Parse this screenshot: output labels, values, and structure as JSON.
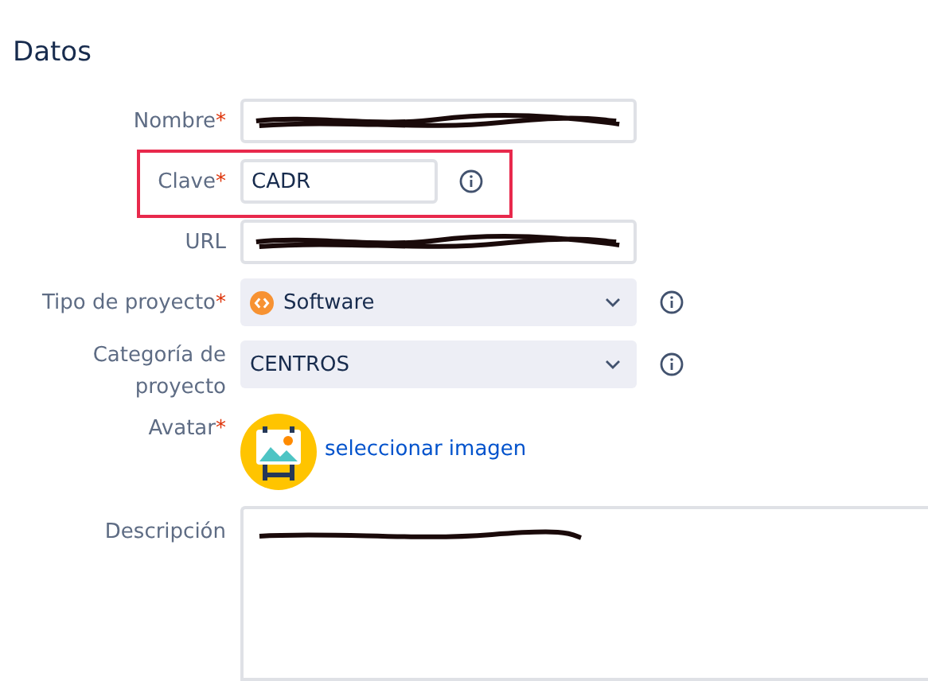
{
  "section_title": "Datos",
  "fields": [
    {
      "kind": "text",
      "label": "Nombre",
      "asterisk": "*",
      "redacted": true,
      "highlighted": false,
      "info": false
    },
    {
      "kind": "text",
      "label": "Clave",
      "asterisk": "*",
      "value": "CADR",
      "redacted": false,
      "highlighted": true,
      "info": true
    },
    {
      "kind": "text",
      "label": "URL",
      "redacted": true,
      "highlighted": false,
      "info": false
    },
    {
      "kind": "select",
      "label": "Tipo de proyecto",
      "asterisk": "*",
      "value": "Software",
      "has_icon": true,
      "info": true
    },
    {
      "kind": "select",
      "label": "Categoría de proyecto",
      "value": "CENTROS",
      "has_icon": false,
      "info": true
    },
    {
      "kind": "avatar",
      "label": "Avatar",
      "asterisk": "*",
      "link": "seleccionar imagen"
    },
    {
      "kind": "textarea",
      "label": "Descripción",
      "redacted": true
    }
  ]
}
